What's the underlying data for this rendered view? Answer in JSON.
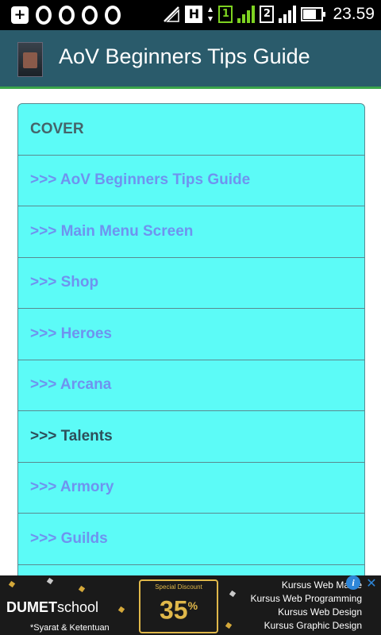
{
  "status_bar": {
    "time": "23.59",
    "sim1_label": "1",
    "sim2_label": "2",
    "network_label": "H"
  },
  "app_bar": {
    "title": "AoV Beginners Tips Guide",
    "icon": "app-cover-icon"
  },
  "list": {
    "header": "COVER",
    "items": [
      ">>> AoV Beginners Tips Guide",
      ">>> Main Menu Screen",
      ">>> Shop",
      ">>> Heroes",
      ">>> Arcana",
      ">>> Talents",
      ">>> Armory",
      ">>> Guilds",
      ""
    ],
    "active_index": 5
  },
  "ad": {
    "brand_bold": "DUMET",
    "brand_light": "school",
    "terms": "*Syarat & Ketentuan",
    "promo_small": "Special Discount",
    "promo_value": "35",
    "promo_suffix": "%",
    "courses": [
      "Kursus Web Maste",
      "Kursus Web Programming",
      "Kursus Web Design",
      "Kursus Graphic Design"
    ],
    "info_icon": "i",
    "close_icon": "✕"
  },
  "colors": {
    "status_bar": "#000000",
    "app_bar": "#2a5b6b",
    "app_bar_border": "#3aa54a",
    "list_bg": "#5cfbf7",
    "link_text": "#6f93ef",
    "active_text": "#2d4f5a"
  }
}
